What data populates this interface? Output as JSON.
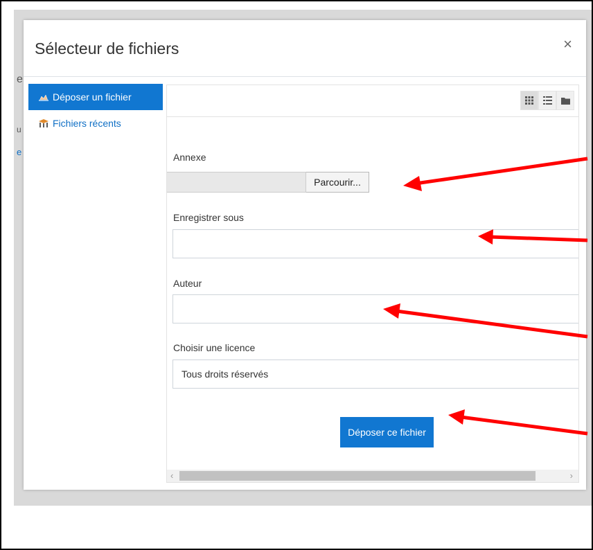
{
  "dialog": {
    "title": "Sélecteur de fichiers",
    "close_glyph": "×"
  },
  "background_fragments": {
    "top": "e",
    "middle": "u",
    "link": "e"
  },
  "sidebar": {
    "items": [
      {
        "label": "Déposer un fichier",
        "icon": "upload-icon",
        "active": true
      },
      {
        "label": "Fichiers récents",
        "icon": "recent-files-icon",
        "active": false
      }
    ]
  },
  "toolbar": {
    "view_buttons": [
      "grid-view-icon",
      "list-view-icon",
      "folder-view-icon"
    ]
  },
  "form": {
    "attachment_label": "Annexe",
    "browse_label": "Parcourir...",
    "save_as_label": "Enregistrer sous",
    "save_as_value": "",
    "author_label": "Auteur",
    "author_value": "",
    "license_label": "Choisir une licence",
    "license_value": "Tous droits réservés",
    "submit_label": "Déposer ce fichier"
  },
  "colors": {
    "primary": "#1177d1",
    "annotation_arrow": "#ff0000"
  }
}
